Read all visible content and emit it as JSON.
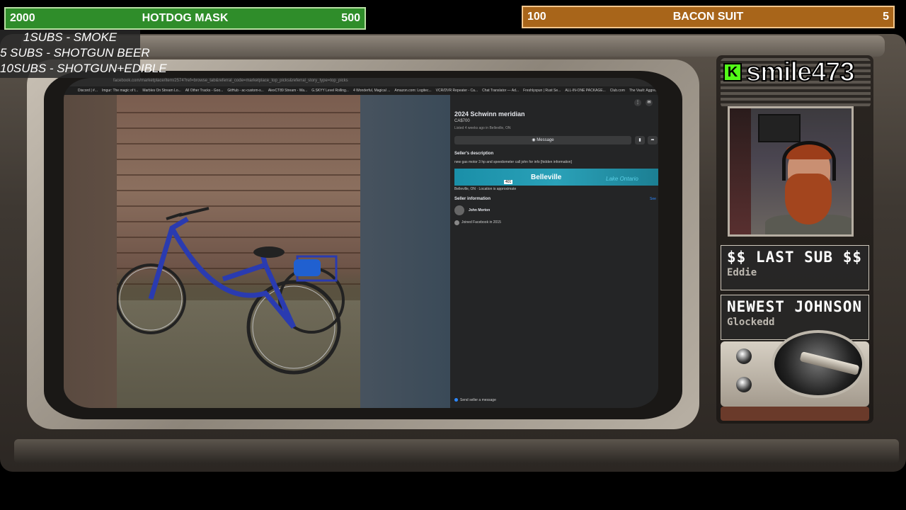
{
  "goals": {
    "left": {
      "current": "2000",
      "name": "HOTDOG MASK",
      "target": "500"
    },
    "right": {
      "current": "100",
      "name": "BACON SUIT",
      "target": "5"
    }
  },
  "sub_rules": [
    "1SUBS   - SMOKE",
    "5 SUBS  - SHOTGUN BEER",
    "10SUBS - SHOTGUN+EDIBLE"
  ],
  "streamer": {
    "channel": "smile473",
    "logo_letter": "K"
  },
  "stats": {
    "last_sub_title": "$$ LAST SUB $$",
    "last_sub_value": "Eddie",
    "newest_title": "NEWEST JOHNSON",
    "newest_value": "Glockedd"
  },
  "browser": {
    "url": "facebook.com/marketplace/item/2574?ref=browse_tab&referral_code=marketplace_top_picks&referral_story_type=top_picks",
    "bookmarks": [
      "Discord | #...",
      "Imgur: The magic of t...",
      "Marbles On Stream Lo...",
      "All Other Tracks - Goo...",
      "GitHub - ac-custom-s...",
      "AlexCT89 Stream - Wa...",
      "G.SKYY Level Rolling...",
      "4 Wonderful, Magical ...",
      "Amazon.com: Logitec...",
      "VCR/DVR Repeater - Ca...",
      "Chat Translator — Ad...",
      "Freshlyspun | Rust Se...",
      "ALL-IN-ONE PACKAGE...",
      "Club.com",
      "The Vault: Aggressive I..."
    ]
  },
  "listing": {
    "title": "2024 Schwinn meridian",
    "price": "CA$700",
    "meta": "Listed 4 weeks ago in Belleville, ON",
    "message_label": "Message",
    "seller_desc_heading": "Seller's description",
    "description": "new gas motor 3 hp and speedometer call john for info [hidden information]",
    "map_city": "Belleville",
    "map_lake": "Lake Ontario",
    "map_highway": "401",
    "location_note": "Belleville, ON · Location is approximate",
    "seller_info_heading": "Seller information",
    "see_all": "See",
    "seller_name": "John Morton",
    "joined": "Joined Facebook in 2015",
    "send_message": "Send seller a message"
  },
  "colors": {
    "goal_left_bg": "#2f8d2a",
    "goal_right_bg": "#a8651a",
    "kick_green": "#53fc18",
    "fb_dark": "#242526"
  }
}
